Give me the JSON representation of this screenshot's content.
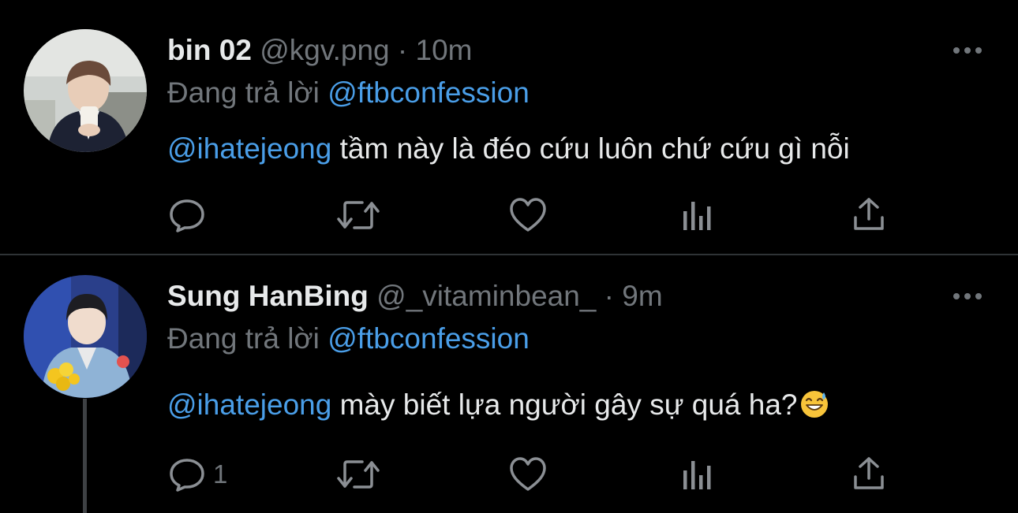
{
  "tweets": [
    {
      "display_name": "bin 02",
      "handle": "@kgv.png",
      "separator": "·",
      "time": "10m",
      "reply_prefix": "Đang trả lời",
      "reply_to": "@ftbconfession",
      "mention": "@ihatejeong",
      "text": " tầm này là đéo cứu luôn chứ cứu gì nỗi",
      "reply_count": "",
      "icons": [
        "reply-icon",
        "retweet-icon",
        "like-icon",
        "analytics-icon",
        "share-icon",
        "more-icon"
      ]
    },
    {
      "display_name": "Sung HanBing",
      "handle": "@_vitaminbean_",
      "separator": "·",
      "time": "9m",
      "reply_prefix": "Đang trả lời",
      "reply_to": "@ftbconfession",
      "mention": "@ihatejeong",
      "text": " mày biết lựa người gây sự quá ha?",
      "emoji": "grinning-sweat-emoji",
      "reply_count": "1",
      "icons": [
        "reply-icon",
        "retweet-icon",
        "like-icon",
        "analytics-icon",
        "share-icon",
        "more-icon"
      ]
    }
  ],
  "colors": {
    "background": "#000000",
    "text": "#e7e9ea",
    "secondary": "#71767b",
    "accent": "#4a9ee8",
    "divider": "#2f3336"
  }
}
